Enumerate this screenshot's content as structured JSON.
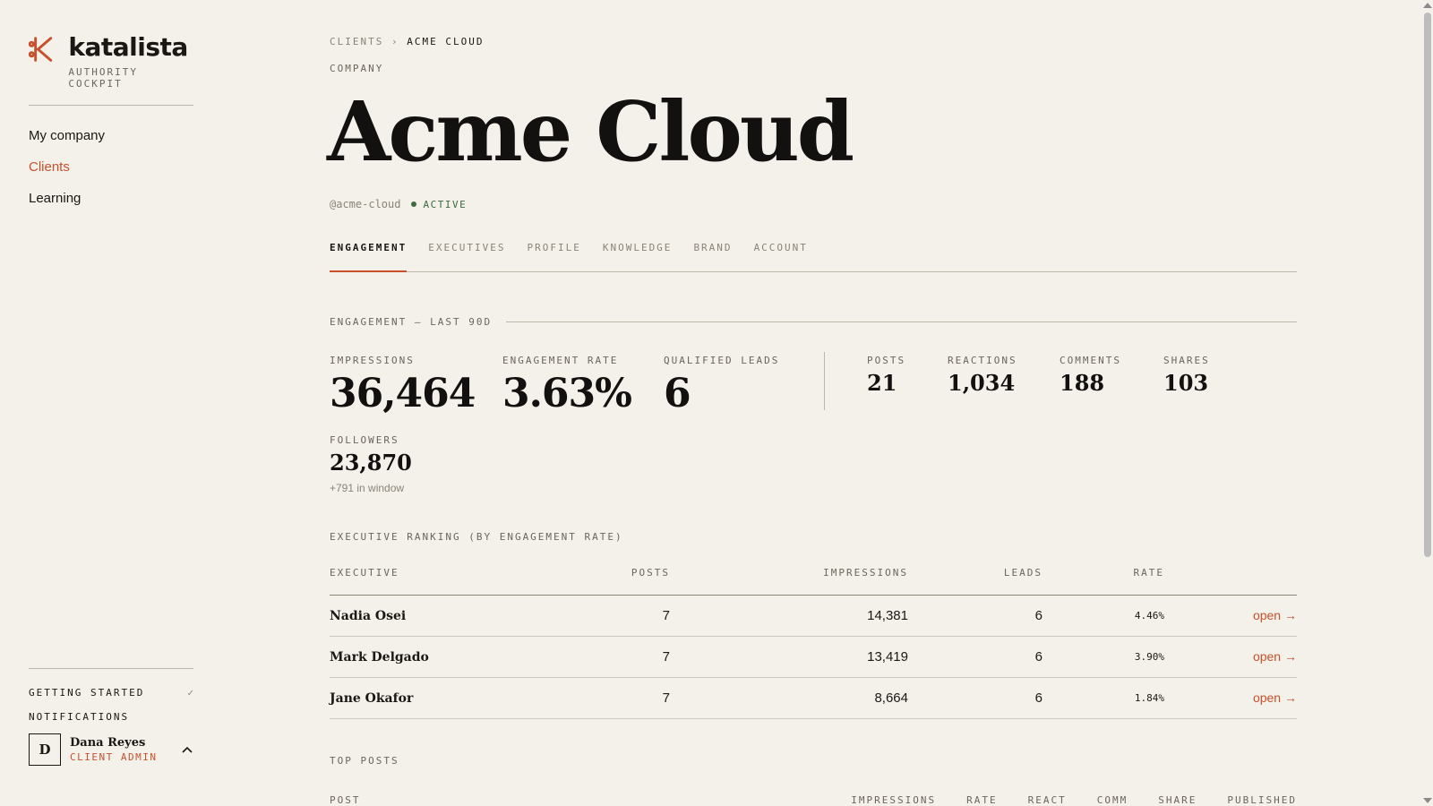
{
  "app": {
    "name": "katalista",
    "tagline": "AUTHORITY COCKPIT",
    "accent": "#c8502c",
    "logo_icon": "katalista-k-logo-icon"
  },
  "sidebar": {
    "items": [
      {
        "label": "My company",
        "active": false
      },
      {
        "label": "Clients",
        "active": true
      },
      {
        "label": "Learning",
        "active": false
      }
    ],
    "bottom": {
      "getting_started": "GETTING STARTED",
      "getting_started_check": "✓",
      "notifications": "NOTIFICATIONS"
    },
    "user": {
      "initial": "D",
      "name": "Dana Reyes",
      "role": "CLIENT ADMIN",
      "toggle_icon": "chevron-up-icon"
    }
  },
  "breadcrumb": {
    "parent": "CLIENTS",
    "separator": "›",
    "current": "ACME CLOUD"
  },
  "company": {
    "eyebrow": "COMPANY",
    "name": "Acme Cloud",
    "handle": "@acme-cloud",
    "status": "ACTIVE",
    "status_color": "#3b6b3e"
  },
  "tabs": [
    {
      "label": "ENGAGEMENT",
      "active": true
    },
    {
      "label": "EXECUTIVES",
      "active": false
    },
    {
      "label": "PROFILE",
      "active": false
    },
    {
      "label": "KNOWLEDGE",
      "active": false
    },
    {
      "label": "BRAND",
      "active": false
    },
    {
      "label": "ACCOUNT",
      "active": false
    }
  ],
  "engagement": {
    "heading": "ENGAGEMENT — LAST 90D",
    "primary": [
      {
        "label": "IMPRESSIONS",
        "value": "36,464"
      },
      {
        "label": "ENGAGEMENT RATE",
        "value": "3.63%"
      },
      {
        "label": "QUALIFIED LEADS",
        "value": "6"
      }
    ],
    "secondary": [
      {
        "label": "POSTS",
        "value": "21"
      },
      {
        "label": "REACTIONS",
        "value": "1,034"
      },
      {
        "label": "COMMENTS",
        "value": "188"
      },
      {
        "label": "SHARES",
        "value": "103"
      }
    ],
    "followers": {
      "label": "FOLLOWERS",
      "value": "23,870",
      "delta": "+791 in window"
    }
  },
  "ranking": {
    "heading": "EXECUTIVE RANKING (BY ENGAGEMENT RATE)",
    "columns": [
      "EXECUTIVE",
      "POSTS",
      "IMPRESSIONS",
      "LEADS",
      "RATE"
    ],
    "open_label": "open →",
    "rows": [
      {
        "name": "Nadia Osei",
        "posts": "7",
        "impressions": "14,381",
        "leads": "6",
        "rate": "4.46%"
      },
      {
        "name": "Mark Delgado",
        "posts": "7",
        "impressions": "13,419",
        "leads": "6",
        "rate": "3.90%"
      },
      {
        "name": "Jane Okafor",
        "posts": "7",
        "impressions": "8,664",
        "leads": "6",
        "rate": "1.84%"
      }
    ]
  },
  "top_posts": {
    "heading": "TOP POSTS",
    "columns": [
      "POST",
      "IMPRESSIONS",
      "RATE",
      "REACT",
      "COMM",
      "SHARE",
      "PUBLISHED"
    ]
  }
}
